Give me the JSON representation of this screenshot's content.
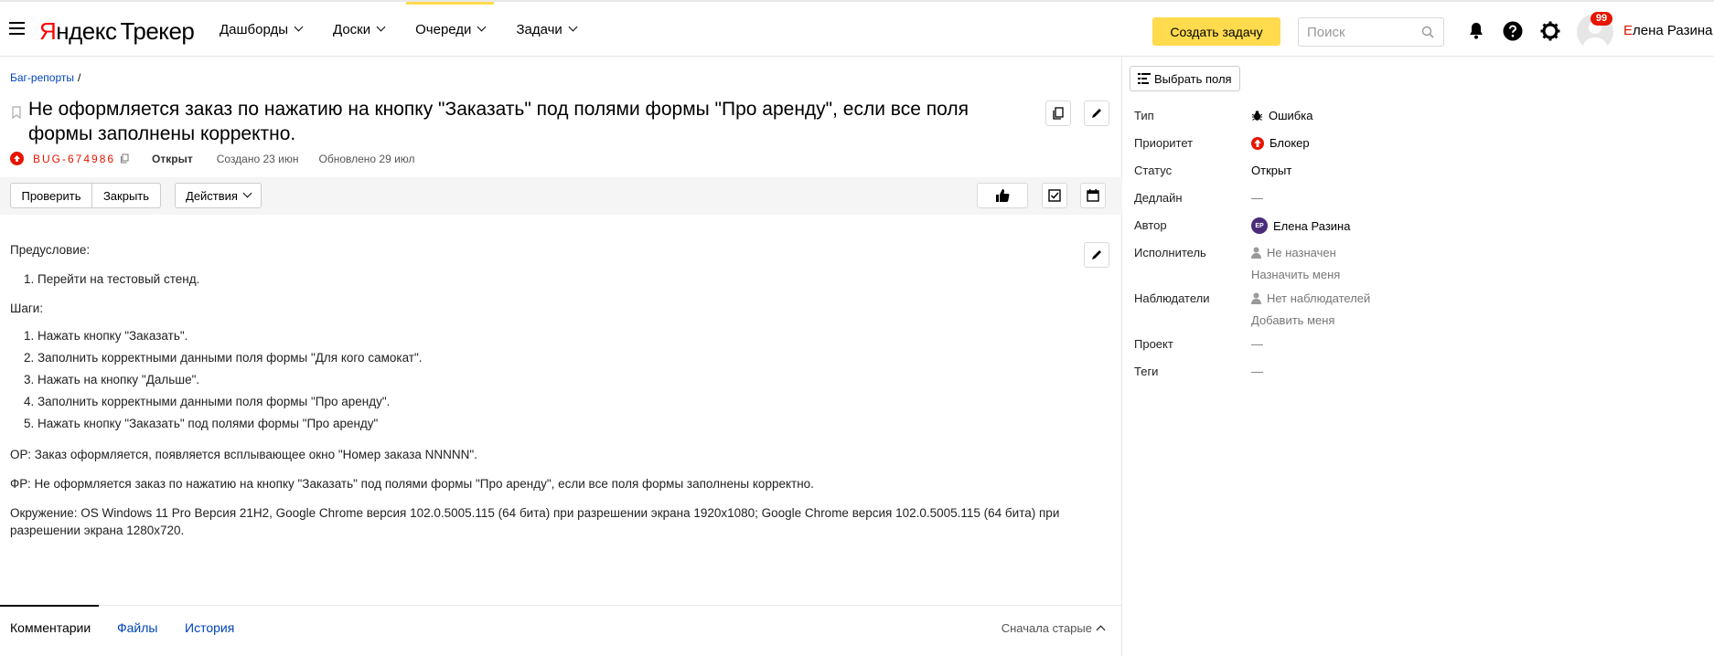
{
  "header": {
    "logo_brand_first": "Я",
    "logo_brand_rest": "ндекс",
    "logo_product": "Трекер",
    "nav": [
      {
        "label": "Дашборды"
      },
      {
        "label": "Доски"
      },
      {
        "label": "Очереди"
      },
      {
        "label": "Задачи"
      }
    ],
    "active_nav": "Очереди",
    "create_button": "Создать задачу",
    "search_placeholder": "Поиск",
    "notifications_count": "99",
    "user_first_letter": "Е",
    "user_rest": "лена Разина",
    "accent_color": "#ffdb4d",
    "brand_red": "#e61400"
  },
  "issue": {
    "breadcrumb_queue": "Баг-репорты",
    "breadcrumb_sep": "/",
    "title": "Не оформляется заказ по нажатию на кнопку \"Заказать\" под полями формы \"Про аренду\", если все поля формы заполнены корректно.",
    "key": "BUG-674986",
    "status": "Открыт",
    "created": "Создано 23 июн",
    "updated": "Обновлено 29 июл"
  },
  "toolbar": {
    "check_button": "Проверить",
    "close_button": "Закрыть",
    "actions_button": "Действия"
  },
  "description": {
    "precondition_title": "Предусловие:",
    "precondition_items": [
      "1. Перейти на тестовый стенд."
    ],
    "steps_title": "Шаги:",
    "steps": [
      "1. Нажать кнопку \"Заказать\".",
      "2. Заполнить корректными данными поля формы \"Для кого самокат\".",
      "3. Нажать на кнопку \"Дальше\".",
      "4. Заполнить корректными данными поля формы \"Про аренду\".",
      "5. Нажать кнопку \"Заказать\" под полями формы \"Про аренду\""
    ],
    "expected": "ОР: Заказ оформляется, появляется всплывающее окно \"Номер заказа NNNNN\".",
    "actual": "ФР: Не оформляется заказ по нажатию на кнопку \"Заказать\" под полями формы \"Про аренду\", если все поля формы заполнены корректно.",
    "environment": "Окружение: OS Windows 11 Pro Версия 21H2, Google Chrome версия 102.0.5005.115 (64 бита) при разрешении экрана 1920x1080; Google Chrome версия 102.0.5005.115 (64 бита) при разрешении экрана 1280x720."
  },
  "tabs": {
    "comments": "Комментарии",
    "files": "Файлы",
    "history": "История",
    "sort": "Сначала старые"
  },
  "sidebar": {
    "choose_fields": "Выбрать поля",
    "fields": [
      {
        "label": "Тип",
        "value": "Ошибка"
      },
      {
        "label": "Приоритет",
        "value": "Блокер"
      },
      {
        "label": "Статус",
        "value": "Открыт"
      },
      {
        "label": "Дедлайн",
        "value": "—"
      },
      {
        "label": "Автор",
        "value": "Елена Разина",
        "initials": "ЕР"
      },
      {
        "label": "Исполнитель",
        "value": "Не назначен",
        "link": "Назначить меня"
      },
      {
        "label": "Наблюдатели",
        "value": "Нет наблюдателей",
        "link": "Добавить меня"
      },
      {
        "label": "Проект",
        "value": "—"
      },
      {
        "label": "Теги",
        "value": "—"
      }
    ]
  }
}
